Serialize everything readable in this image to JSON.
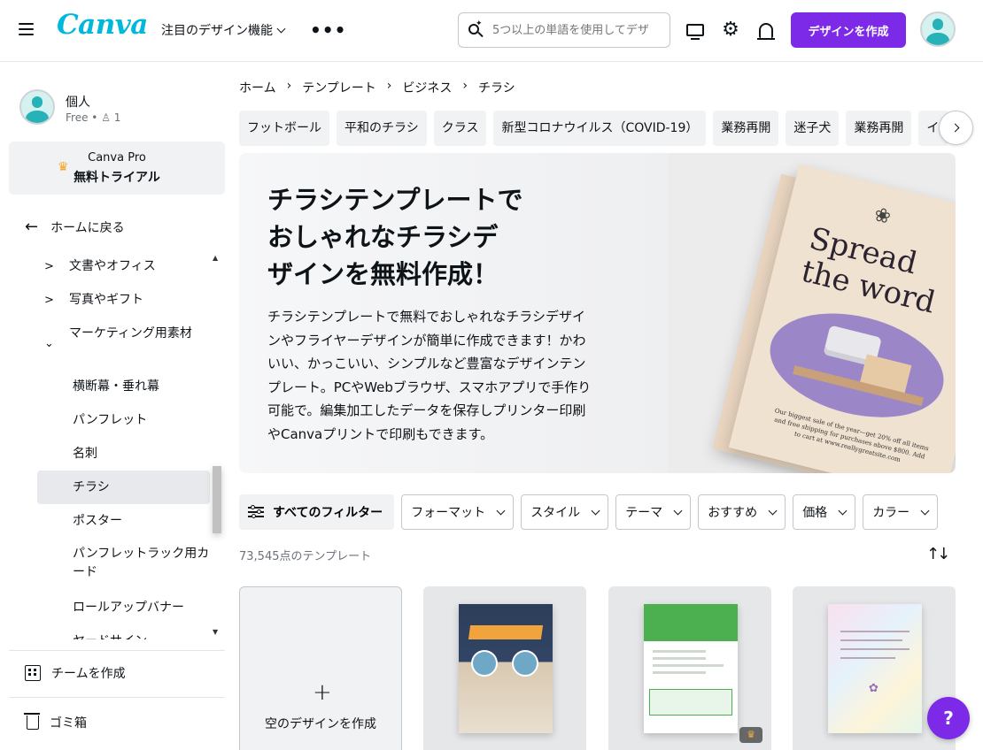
{
  "topbar": {
    "logo_text": "Canva",
    "feature_menu_label": "注目のデザイン機能",
    "more_label": "•••",
    "search_placeholder": "5つ以上の単語を使用してデザ",
    "create_button_label": "デザインを作成",
    "brand_color": "#7d2ae8",
    "icons": [
      "menu-icon",
      "monitor-icon",
      "gear-icon",
      "bell-icon"
    ]
  },
  "sidebar": {
    "account_name": "個人",
    "account_plan": "Free",
    "account_members": "1",
    "pro_line1": "Canva Pro",
    "pro_line2": "無料トライアル",
    "back_home": "ホームに戻る",
    "tree": [
      {
        "label": "文書やオフィス",
        "expanded": false
      },
      {
        "label": "写真やギフト",
        "expanded": false
      },
      {
        "label": "マーケティング用素材",
        "expanded": true
      }
    ],
    "sub_items": [
      "横断幕・垂れ幕",
      "パンフレット",
      "名刺",
      "チラシ",
      "ポスター",
      "パンフレットラック用カード",
      "ロールアップバナー",
      "ヤードサイン"
    ],
    "active_sub_item": "チラシ",
    "create_team": "チームを作成",
    "trash": "ゴミ箱"
  },
  "breadcrumb": [
    "ホーム",
    "テンプレート",
    "ビジネス",
    "チラシ"
  ],
  "chips": [
    "フットボール",
    "平和のチラシ",
    "クラス",
    "新型コロナウイルス（COVID-19）",
    "業務再開",
    "迷子犬",
    "業務再開",
    "イベント"
  ],
  "hero": {
    "title_lines": [
      "チラシテンプレートで",
      "おしゃれなチラシデ",
      "ザインを無料作成！"
    ],
    "description": "チラシテンプレートで無料でおしゃれなチラシデザインやフライヤーデザインが簡単に作成できます！かわいい、かっこいい、シンプルなど豊富なデザインテンプレート。PCやWebブラウザ、スマホアプリで手作り可能で。編集加工したデータを保存しプリンター印刷やCanvaプリントで印刷もできます。",
    "art_title_1": "Spread",
    "art_title_2": "the word",
    "art_fine_print": "Our biggest sale of the year—get 20% off all items and free shipping for purchases above $800. Add to cart at www.reallygreatsite.com"
  },
  "filters": {
    "all_label": "すべてのフィルター",
    "dropdowns": [
      "フォーマット",
      "スタイル",
      "テーマ",
      "おすすめ",
      "価格",
      "カラー"
    ]
  },
  "results": {
    "count_text": "73,545点のテンプレート",
    "blank_card_label": "空のデザインを作成",
    "blank_card_plus": "+",
    "pro_badge": "♛"
  },
  "help_label": "?"
}
